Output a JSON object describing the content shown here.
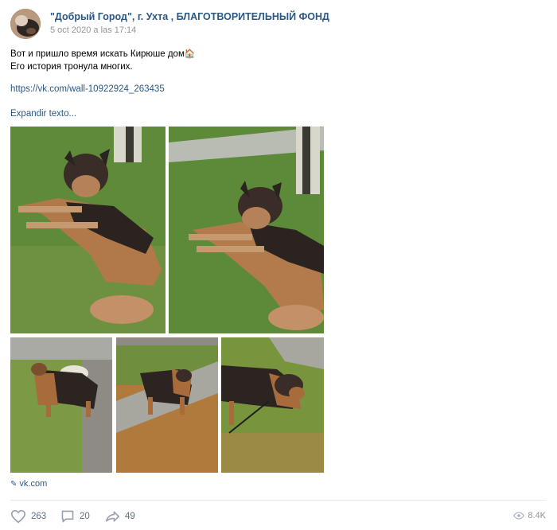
{
  "post": {
    "author": "\"Добрый Город\", г. Ухта , БЛАГОТВОРИТЕЛЬНЫЙ ФОНД",
    "date": "5 oct 2020 a las 17:14",
    "text_line1": "Вот и пришло время искать Кирюше дом",
    "text_line1_emoji": "🏠",
    "text_line2": "Его история тронула многих.",
    "link": "https://vk.com/wall-10922924_263435",
    "expand_label": "Expandir texto...",
    "source_label": "vk.com"
  },
  "actions": {
    "likes": "263",
    "comments": "20",
    "shares": "49",
    "views": "8.4K"
  },
  "icons": {
    "like": "heart-icon",
    "comment": "comment-icon",
    "share": "share-arrow-icon",
    "views": "eye-icon",
    "source": "pin-icon"
  },
  "colors": {
    "link": "#2a5885",
    "muted": "#939393",
    "divider": "#e7e8ec"
  }
}
